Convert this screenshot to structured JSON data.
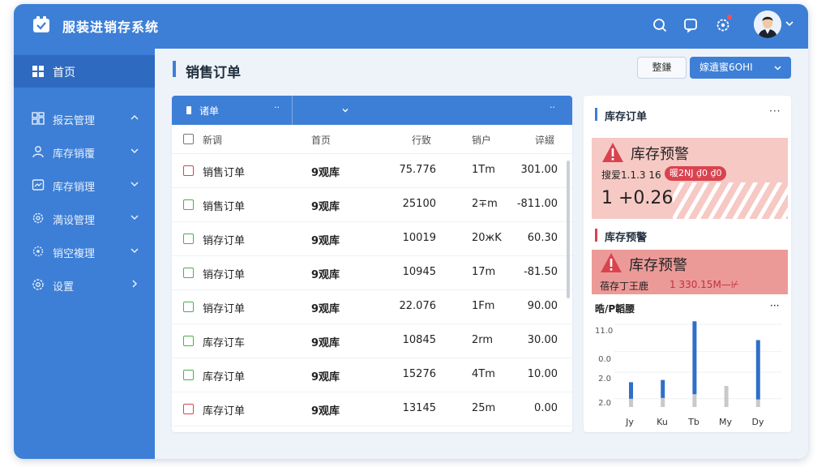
{
  "app": {
    "title": "服装进销存系统"
  },
  "header_icons": [
    "search-icon",
    "chat-icon",
    "settings-icon"
  ],
  "sidebar": {
    "home": "首页",
    "items": [
      {
        "label": "报云管理",
        "icon": "report-icon",
        "chevron": "up"
      },
      {
        "label": "库存销覆",
        "icon": "user-icon",
        "chevron": "down"
      },
      {
        "label": "库存销理",
        "icon": "inventory-icon",
        "chevron": "down"
      },
      {
        "label": "満设管理",
        "icon": "cog-icon",
        "chevron": "down"
      },
      {
        "label": "销空複理",
        "icon": "settings-gear-icon",
        "chevron": "down"
      },
      {
        "label": "设置",
        "icon": "gear-icon",
        "chevron": "right"
      }
    ]
  },
  "page": {
    "title": "销售订单",
    "secondary_button": "整鎌",
    "primary_button": "嫁遺蜜6OHI"
  },
  "table": {
    "filter_label": "诸单",
    "headers": {
      "name": "新调",
      "store": "首页",
      "qty": "行致",
      "unit": "销户",
      "amount": "谇綴"
    },
    "rows": [
      {
        "name": "销售订单",
        "store": "9观库",
        "qty": "75.776",
        "unit": "1Tm",
        "amount": "301.00",
        "status": "red"
      },
      {
        "name": "销售订单",
        "store": "9观库",
        "qty": "25100",
        "unit": "2∓m",
        "amount": "-811.00",
        "status": "green"
      },
      {
        "name": "销存订单",
        "store": "9观库",
        "qty": "10019",
        "unit": "20жK",
        "amount": "60.30",
        "status": "green"
      },
      {
        "name": "销存订单",
        "store": "9观库",
        "qty": "10945",
        "unit": "17m",
        "amount": "-81.50",
        "status": "green"
      },
      {
        "name": "销存订单",
        "store": "9观库",
        "qty": "22.076",
        "unit": "1Fm",
        "amount": "90.00",
        "status": "green"
      },
      {
        "name": "库存订车",
        "store": "9观库",
        "qty": "10845",
        "unit": "2rm",
        "amount": "30.00",
        "status": "green"
      },
      {
        "name": "库存订单",
        "store": "9观库",
        "qty": "15276",
        "unit": "4Tm",
        "amount": "10.00",
        "status": "green"
      },
      {
        "name": "库存订单",
        "store": "9观库",
        "qty": "13145",
        "unit": "25m",
        "amount": "0.00",
        "status": "red"
      }
    ]
  },
  "right": {
    "section1_title": "库存订单",
    "alert1": {
      "title": "库存预警",
      "sub": "搜爱1.1.3 16",
      "tag": "暖2NJ ₫0 ₫0",
      "big": "1 +0.26"
    },
    "section2_title": "库存预警",
    "alert2": {
      "title": "库存预警",
      "sub": "蓓存丁王鹿",
      "amount": "1 330.15M—⊬"
    },
    "chart_title": "晧/P韜腰"
  },
  "chart_data": {
    "type": "bar",
    "categories": [
      "Jy",
      "Ku",
      "Tb",
      "My",
      "Dy"
    ],
    "ytick_labels": [
      "11.0",
      "0.0",
      "2.0",
      "2.0"
    ],
    "series": [
      {
        "values": [
          2.2,
          2.4,
          9.7,
          0,
          7.9
        ]
      },
      {
        "values": [
          1.1,
          1.2,
          1.7,
          2.8,
          1.0
        ]
      }
    ],
    "ylim": [
      0,
      11
    ],
    "colors": [
      "#2f6fc9",
      "#c9c9c9"
    ]
  },
  "colors": {
    "brand": "#3d7fd6",
    "alert": "#d9434f",
    "ok": "#4caf50"
  }
}
